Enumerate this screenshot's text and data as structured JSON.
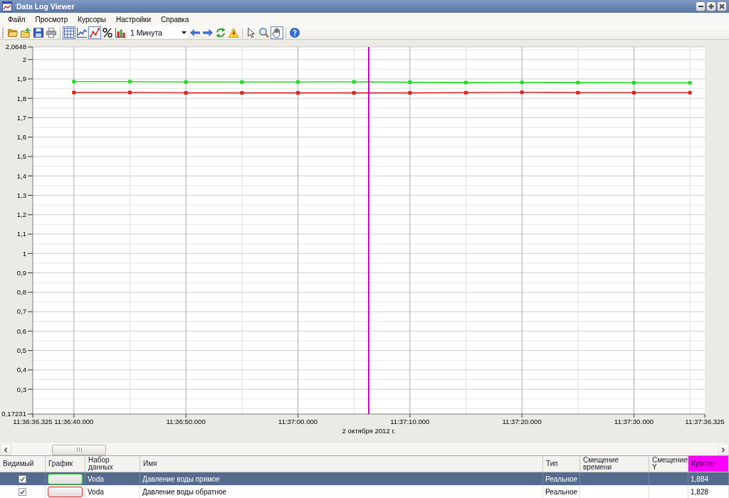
{
  "window": {
    "title": "Data Log Viewer"
  },
  "menu": [
    "Файл",
    "Просмотр",
    "Курсоры",
    "Настройки",
    "Справка"
  ],
  "toolbar": [
    {
      "kind": "button",
      "pressed": false
    },
    {
      "kind": "button",
      "pressed": false
    },
    {
      "kind": "button",
      "pressed": false
    },
    {
      "kind": "button",
      "pressed": false
    },
    {
      "kind": "separator"
    },
    {
      "kind": "button",
      "pressed": true
    },
    {
      "kind": "button",
      "pressed": false
    },
    {
      "kind": "button",
      "pressed": true
    },
    {
      "kind": "button",
      "pressed": false
    },
    {
      "kind": "button",
      "pressed": false
    },
    {
      "kind": "dropdown",
      "value": "1 Минута"
    },
    {
      "kind": "button",
      "pressed": false
    },
    {
      "kind": "button",
      "pressed": false
    },
    {
      "kind": "button",
      "pressed": false
    },
    {
      "kind": "button",
      "pressed": false
    },
    {
      "kind": "separator"
    },
    {
      "kind": "button",
      "pressed": false
    },
    {
      "kind": "button",
      "pressed": false
    },
    {
      "kind": "button",
      "pressed": true
    },
    {
      "kind": "separator"
    },
    {
      "kind": "button",
      "pressed": false
    }
  ],
  "chart": {
    "range_start": "11:36:36.325",
    "range_end": "11:37:36.325",
    "cursor": {
      "level": 0.5
    },
    "chart_data": {
      "type": "line",
      "xlabel": "2 октября 2012 г.",
      "grid": true,
      "categories": [
        "11:36:40.000",
        null,
        "11:36:50.000",
        null,
        "11:37:00.000",
        null,
        "11:37:10.000",
        null,
        "11:37:20.000",
        null,
        "11:37:30.000",
        null
      ],
      "ylim": [
        0.17231,
        2.0648
      ],
      "yticks": [
        {
          "value": 0.17231,
          "label": "0,17231"
        },
        {
          "value": 0.3,
          "label": "0,3"
        },
        {
          "value": 0.4,
          "label": "0,4"
        },
        {
          "value": 0.5,
          "label": "0,5"
        },
        {
          "value": 0.6,
          "label": "0,6"
        },
        {
          "value": 0.7,
          "label": "0,7"
        },
        {
          "value": 0.8,
          "label": "0,8"
        },
        {
          "value": 0.9,
          "label": "0,9"
        },
        {
          "value": 1,
          "label": "1"
        },
        {
          "value": 1.1,
          "label": "1,1"
        },
        {
          "value": 1.2,
          "label": "1,2"
        },
        {
          "value": 1.3,
          "label": "1,3"
        },
        {
          "value": 1.4,
          "label": "1,4"
        },
        {
          "value": 1.5,
          "label": "1,5"
        },
        {
          "value": 1.6,
          "label": "1,6"
        },
        {
          "value": 1.7,
          "label": "1,7"
        },
        {
          "value": 1.8,
          "label": "1,8"
        },
        {
          "value": 1.9,
          "label": "1,9"
        },
        {
          "value": 2,
          "label": "2"
        },
        {
          "value": 2.0648,
          "label": "2,0648"
        }
      ],
      "series": [
        {
          "color": "#22dd22",
          "marker": "square",
          "values": [
            1.886,
            1.886,
            1.884,
            1.884,
            1.884,
            1.885,
            1.883,
            1.881,
            1.882,
            1.881,
            1.88,
            1.88
          ]
        },
        {
          "color": "#e02222",
          "marker": "square",
          "values": [
            1.83,
            1.83,
            1.828,
            1.828,
            1.828,
            1.828,
            1.828,
            1.829,
            1.831,
            1.829,
            1.829,
            1.829
          ]
        }
      ]
    }
  },
  "table": {
    "columns": [
      {
        "label": "Видимый"
      },
      {
        "label": "График"
      },
      {
        "label": "Набор данных"
      },
      {
        "label": "Имя"
      },
      {
        "label": "Тип"
      },
      {
        "label": "Смещение времени"
      },
      {
        "label": "Смещение Y"
      },
      {
        "label": "Курсор",
        "color": "#ff00ff"
      }
    ],
    "rows": [
      {
        "selected": true,
        "visible": true,
        "color": "#22dd22",
        "dataset": "Voda",
        "name": "Давление воды прямое",
        "type": "Реальное",
        "cursor": "1,884"
      },
      {
        "selected": false,
        "visible": true,
        "color": "#e02222",
        "dataset": "Voda",
        "name": "Давление воды обратное",
        "type": "Реальное",
        "cursor": "1,828"
      }
    ]
  }
}
